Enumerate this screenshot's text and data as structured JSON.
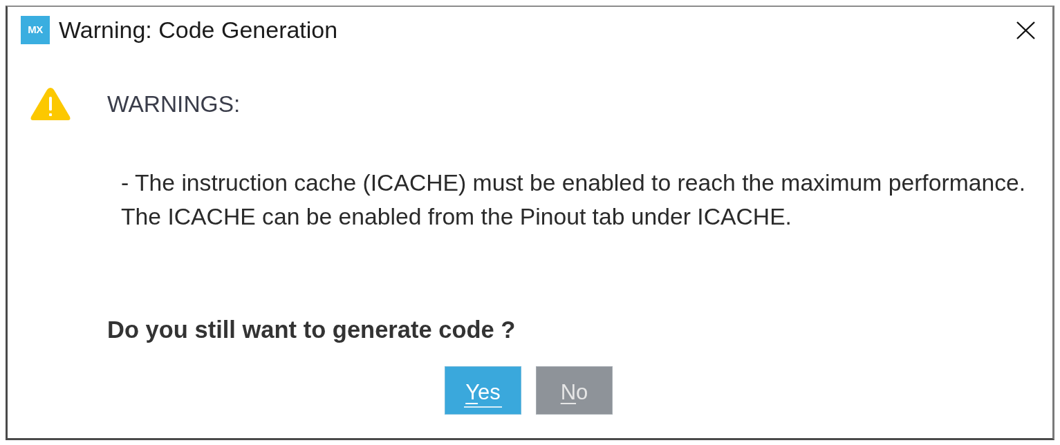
{
  "window": {
    "title": "Warning: Code Generation",
    "logo_text": "MX"
  },
  "message": {
    "heading": "WARNINGS:",
    "lines": [
      "- The instruction cache (ICACHE) must be enabled to reach the maximum performance.",
      "The ICACHE can be enabled from the Pinout tab under ICACHE."
    ],
    "question": "Do you still want to generate code ?"
  },
  "buttons": [
    {
      "label": "Yes",
      "kind": "primary",
      "focused": true
    },
    {
      "label": "No",
      "kind": "secondary",
      "focused": false
    }
  ]
}
